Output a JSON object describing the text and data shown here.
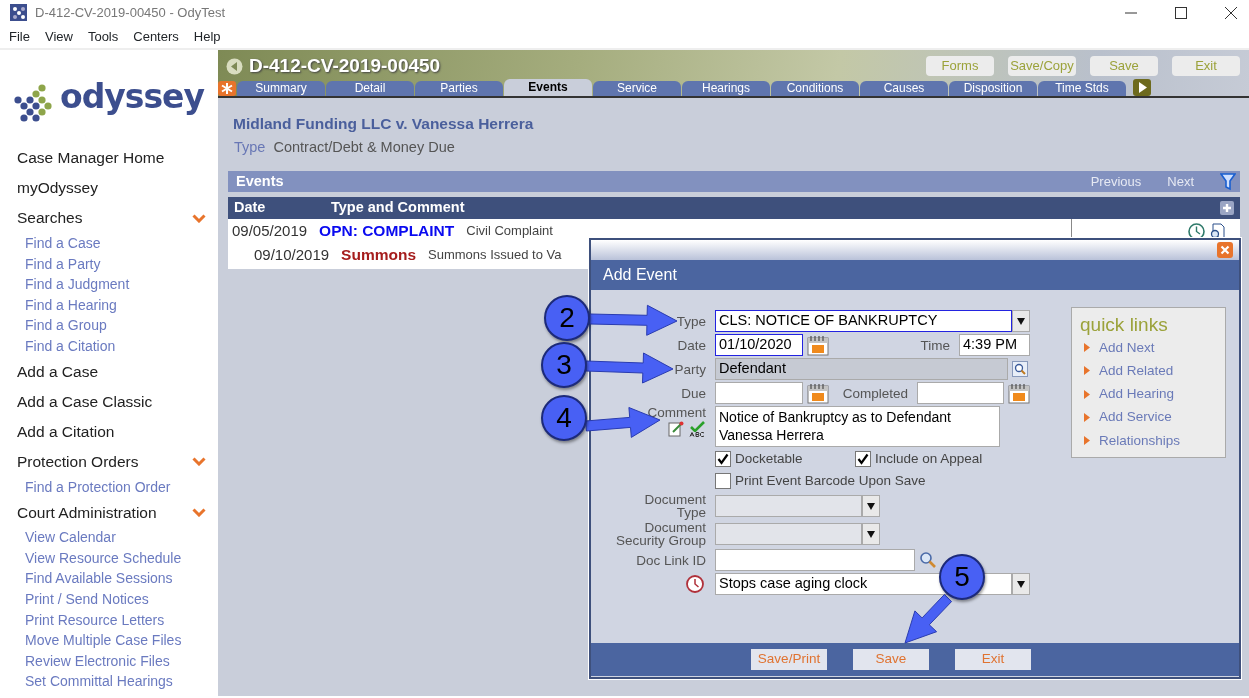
{
  "window": {
    "title": "D-412-CV-2019-00450 - OdyTest"
  },
  "menu": [
    "File",
    "View",
    "Tools",
    "Centers",
    "Help"
  ],
  "sidebar": {
    "logo_text": "odyssey",
    "items": [
      {
        "kind": "link",
        "label": "Case Manager Home"
      },
      {
        "kind": "link",
        "label": "myOdyssey"
      },
      {
        "kind": "group",
        "label": "Searches",
        "expanded": true,
        "children": [
          {
            "label": "Find a Case"
          },
          {
            "label": "Find a Party"
          },
          {
            "label": "Find a Judgment"
          },
          {
            "label": "Find a Hearing"
          },
          {
            "label": "Find a Group"
          },
          {
            "label": "Find a Citation"
          }
        ]
      },
      {
        "kind": "link",
        "label": "Add a Case"
      },
      {
        "kind": "link",
        "label": "Add a Case Classic"
      },
      {
        "kind": "link",
        "label": "Add a Citation"
      },
      {
        "kind": "group",
        "label": "Protection Orders",
        "expanded": true,
        "children": [
          {
            "label": "Find a Protection Order"
          }
        ]
      },
      {
        "kind": "group",
        "label": "Court Administration",
        "expanded": true,
        "children": [
          {
            "label": "View Calendar"
          },
          {
            "label": "View Resource Schedule"
          },
          {
            "label": "Find Available Sessions"
          },
          {
            "label": "Print / Send Notices"
          },
          {
            "label": "Print Resource Letters"
          },
          {
            "label": "Move Multiple Case Files"
          },
          {
            "label": "Review Electronic Files"
          },
          {
            "label": "Set Committal Hearings"
          }
        ]
      }
    ]
  },
  "case": {
    "number": "D-412-CV-2019-00450",
    "buttons": [
      "Forms",
      "Save/Copy",
      "Save",
      "Exit"
    ],
    "tabs": [
      {
        "label": "Summary",
        "selected": false
      },
      {
        "label": "Detail",
        "selected": false
      },
      {
        "label": "Parties",
        "selected": false
      },
      {
        "label": "Events",
        "selected": true
      },
      {
        "label": "Service",
        "selected": false
      },
      {
        "label": "Hearings",
        "selected": false
      },
      {
        "label": "Conditions",
        "selected": false
      },
      {
        "label": "Causes",
        "selected": false
      },
      {
        "label": "Disposition",
        "selected": false
      },
      {
        "label": "Time Stds",
        "selected": false
      }
    ],
    "title": "Midland Funding LLC v. Vanessa Herrera",
    "type_label": "Type",
    "type_value": "Contract/Debt & Money Due"
  },
  "events": {
    "title": "Events",
    "nav": [
      "Previous",
      "Next"
    ],
    "columns": [
      "Date",
      "Type and Comment"
    ],
    "rows": [
      {
        "date": "09/05/2019",
        "type": "OPN: COMPLAINT",
        "color": "#0a0af0",
        "comment": "Civil Complaint",
        "children": [
          {
            "date": "09/10/2019",
            "type": "Summons",
            "color": "#a51d1d",
            "comment": "Summons Issued to Va"
          }
        ]
      }
    ]
  },
  "dialog": {
    "title": "Add Event",
    "type": {
      "label": "Type",
      "value": "CLS: NOTICE OF BANKRUPTCY",
      "highlighted": true
    },
    "date": {
      "label": "Date",
      "value": "01/10/2020",
      "highlighted": true
    },
    "time": {
      "label": "Time",
      "value": "4:39 PM"
    },
    "party": {
      "label": "Party",
      "value": "Defendant"
    },
    "due": {
      "label": "Due"
    },
    "completed": {
      "label": "Completed"
    },
    "comment": {
      "label": "Comment",
      "value": "Notice of Bankruptcy as to Defendant Vanessa Herrera"
    },
    "checkboxes": [
      {
        "label": "Docketable",
        "checked": true
      },
      {
        "label": "Include on Appeal",
        "checked": true
      },
      {
        "label": "Print Event Barcode Upon Save",
        "checked": false
      }
    ],
    "document_type": {
      "label": "Document Type",
      "disabled": true
    },
    "document_security_group": {
      "label": "Document Security Group",
      "disabled": true
    },
    "doc_link_id": {
      "label": "Doc Link ID"
    },
    "aging": {
      "value": "Stops case aging clock"
    },
    "quick_links": {
      "title": "quick links",
      "items": [
        "Add Next",
        "Add Related",
        "Add Hearing",
        "Add Service",
        "Relationships"
      ]
    },
    "buttons": [
      "Save/Print",
      "Save",
      "Exit"
    ]
  },
  "callouts": [
    {
      "number": "2"
    },
    {
      "number": "3"
    },
    {
      "number": "4"
    },
    {
      "number": "5"
    }
  ]
}
